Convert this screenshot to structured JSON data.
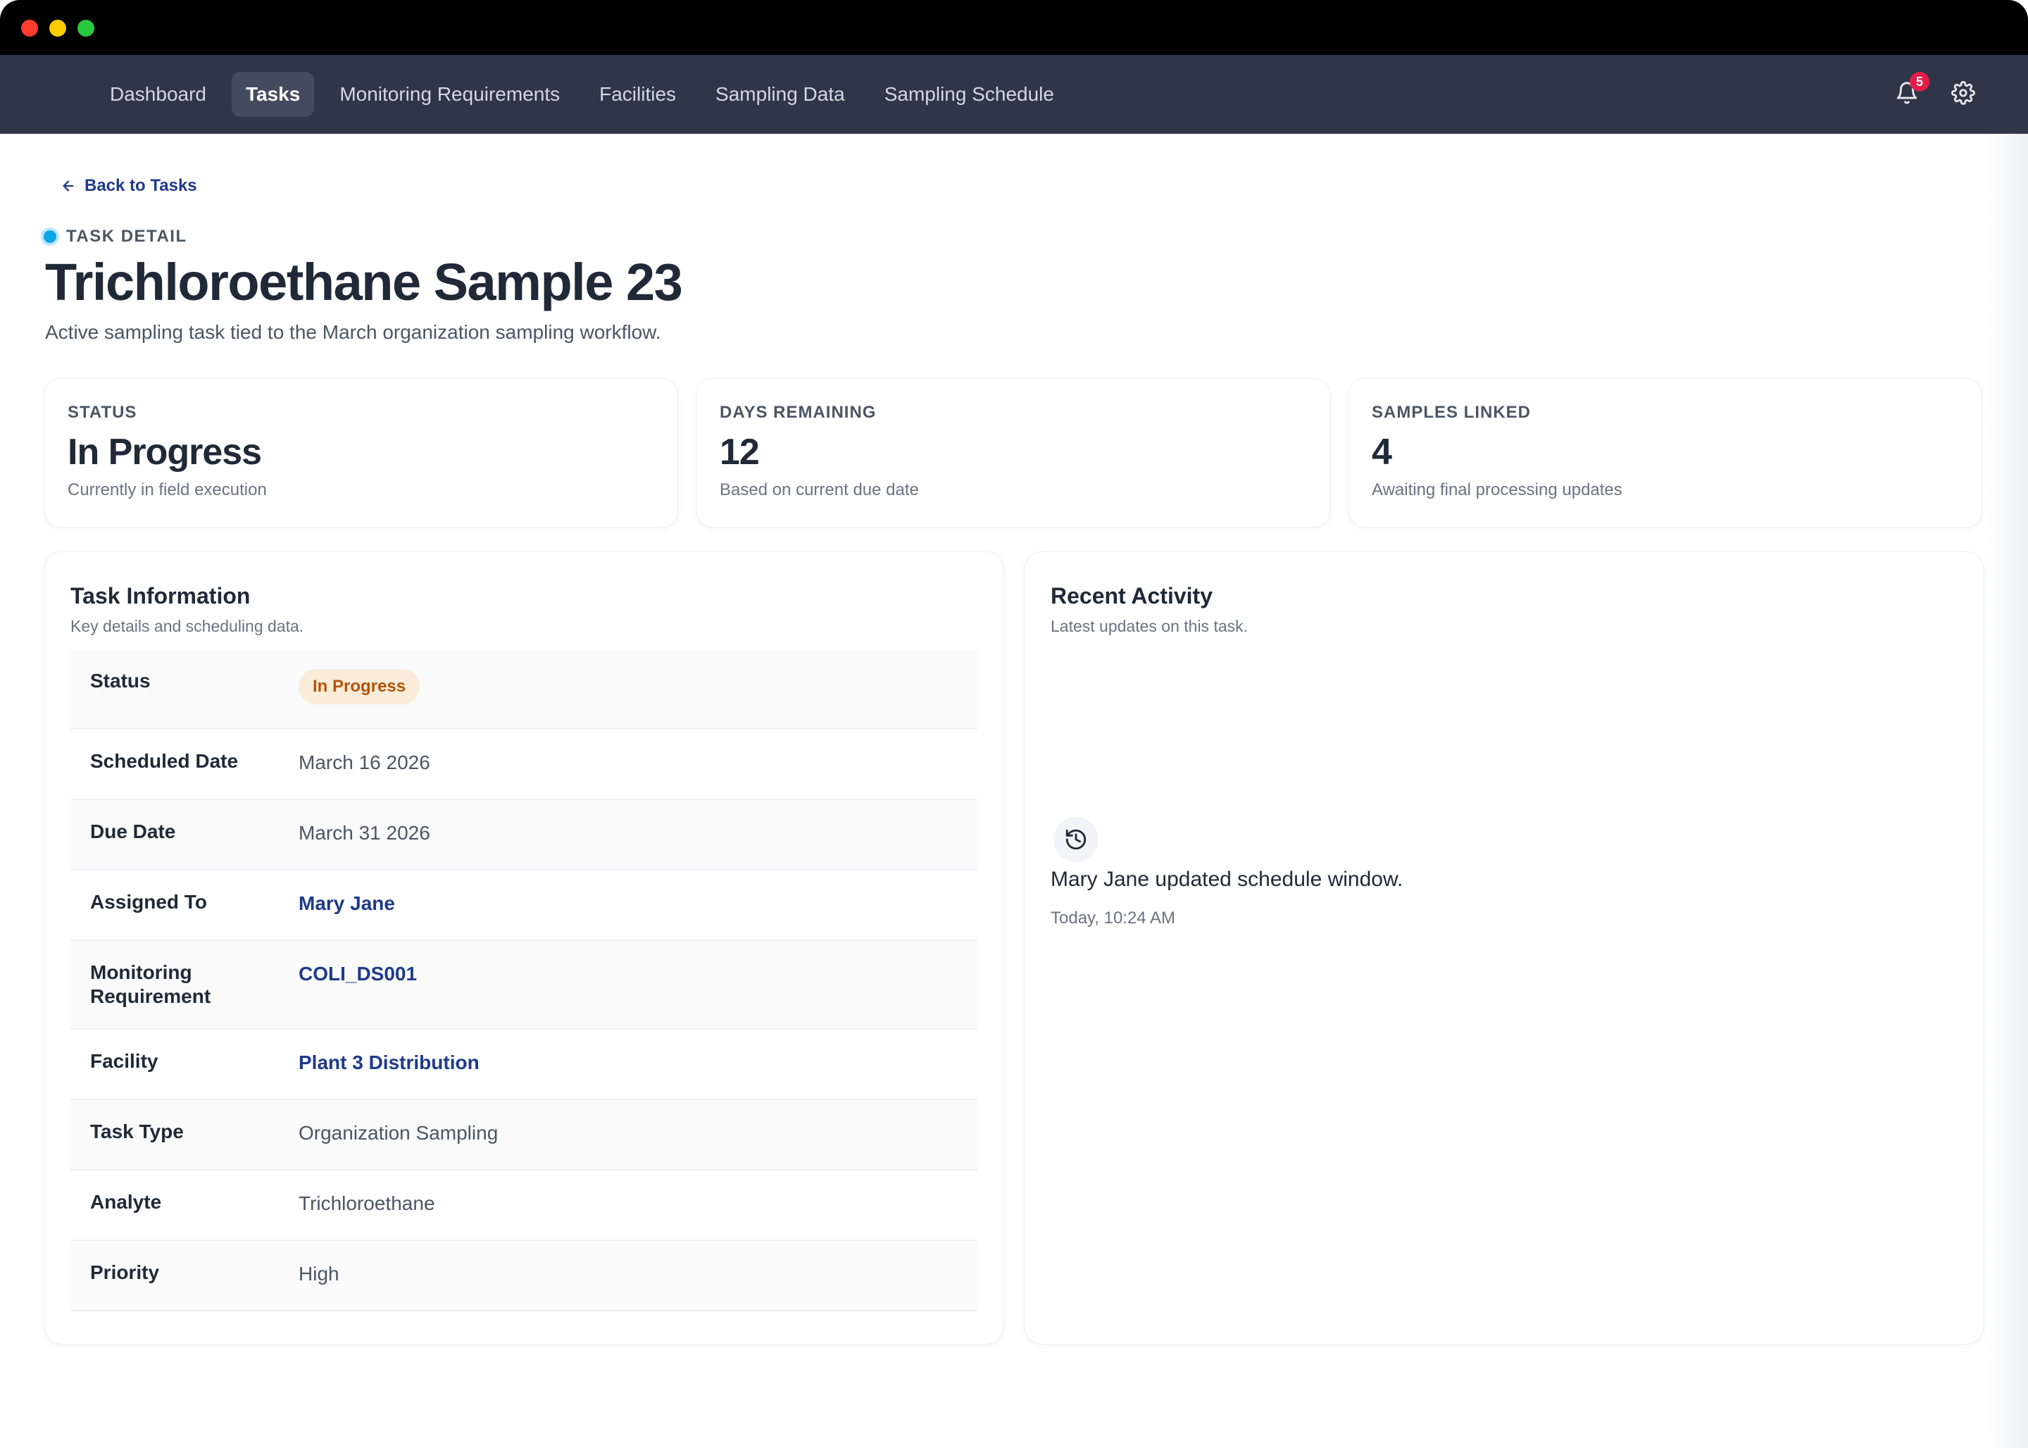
{
  "nav": {
    "items": [
      {
        "label": "Dashboard",
        "active": false
      },
      {
        "label": "Tasks",
        "active": true
      },
      {
        "label": "Monitoring Requirements",
        "active": false
      },
      {
        "label": "Facilities",
        "active": false
      },
      {
        "label": "Sampling Data",
        "active": false
      },
      {
        "label": "Sampling Schedule",
        "active": false
      }
    ],
    "notifications_count": "5"
  },
  "page": {
    "back_label": "Back to Tasks",
    "eyebrow": "TASK DETAIL",
    "title": "Trichloroethane Sample 23",
    "subtitle": "Active sampling task tied to the March organization sampling workflow."
  },
  "stats": [
    {
      "label": "STATUS",
      "value": "In Progress",
      "hint": "Currently in field execution"
    },
    {
      "label": "DAYS REMAINING",
      "value": "12",
      "hint": "Based on current due date"
    },
    {
      "label": "SAMPLES LINKED",
      "value": "4",
      "hint": "Awaiting final processing updates"
    }
  ],
  "task_info": {
    "title": "Task Information",
    "subtitle": "Key details and scheduling data.",
    "rows": [
      {
        "key": "Status",
        "value": "In Progress",
        "type": "pill"
      },
      {
        "key": "Scheduled Date",
        "value": "March 16 2026",
        "type": "text"
      },
      {
        "key": "Due Date",
        "value": "March 31 2026",
        "type": "text"
      },
      {
        "key": "Assigned To",
        "value": "Mary Jane",
        "type": "link"
      },
      {
        "key": "Monitoring Requirement",
        "value": "COLI_DS001",
        "type": "link"
      },
      {
        "key": "Facility",
        "value": "Plant 3 Distribution",
        "type": "link"
      },
      {
        "key": "Task Type",
        "value": "Organization Sampling",
        "type": "text"
      },
      {
        "key": "Analyte",
        "value": "Trichloroethane",
        "type": "text"
      },
      {
        "key": "Priority",
        "value": "High",
        "type": "text"
      }
    ]
  },
  "activity": {
    "title": "Recent Activity",
    "subtitle": "Latest updates on this task.",
    "items": [
      {
        "icon": "history-icon",
        "text": "Mary Jane updated schedule window.",
        "time": "Today, 10:24 AM"
      }
    ]
  },
  "colors": {
    "nav_bg": "#2e3647",
    "link": "#1e3a8a",
    "pill_bg": "#fbecd9",
    "pill_text": "#b45309",
    "badge": "#e11d48"
  }
}
